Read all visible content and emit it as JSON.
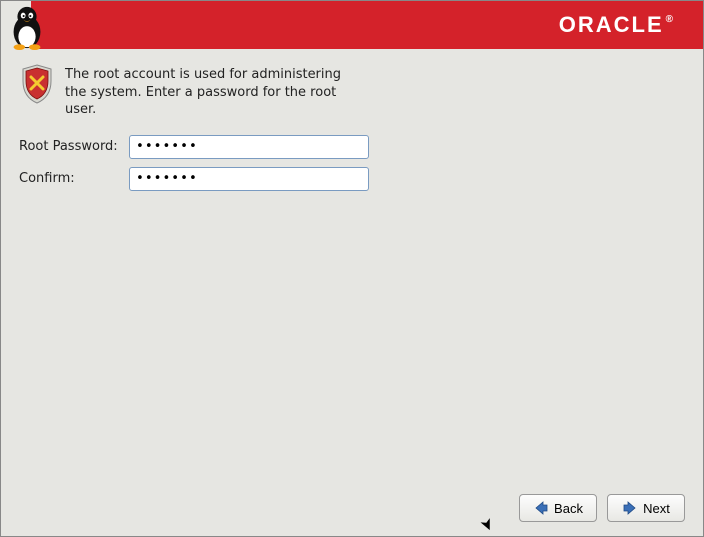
{
  "header": {
    "brand": "ORACLE"
  },
  "info": {
    "text": "The root account is used for administering the system.  Enter a password for the root user."
  },
  "form": {
    "root_password_label": "Root Password:",
    "confirm_label": "Confirm:",
    "root_password_value": "•••••••",
    "confirm_value": "•••••••"
  },
  "buttons": {
    "back": "Back",
    "next": "Next"
  }
}
